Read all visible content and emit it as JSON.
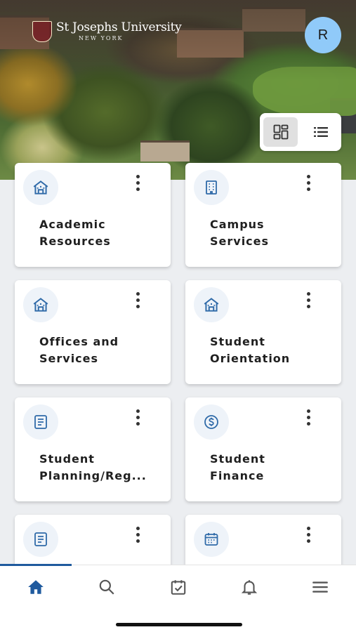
{
  "header": {
    "logo_name": "St Josephs University",
    "logo_subtitle": "NEW YORK",
    "avatar_initial": "R"
  },
  "view_toggle": {
    "selected": "grid",
    "options": [
      "grid-view-icon",
      "list-view-icon"
    ]
  },
  "cards": [
    {
      "title": "Academic\nResources",
      "icon": "building-icon"
    },
    {
      "title": "Campus\nServices",
      "icon": "office-building-icon"
    },
    {
      "title": "Offices and\nServices",
      "icon": "building-icon"
    },
    {
      "title": "Student\nOrientation",
      "icon": "building-icon"
    },
    {
      "title": "Student\nPlanning/Reg...",
      "icon": "book-icon"
    },
    {
      "title": "Student\nFinance",
      "icon": "dollar-coin-icon"
    },
    {
      "title": "",
      "icon": "book-icon"
    },
    {
      "title": "",
      "icon": "calendar-icon"
    }
  ],
  "bottom_nav": {
    "active": "home",
    "items": [
      "home-icon",
      "search-icon",
      "calendar-check-icon",
      "bell-icon",
      "menu-icon"
    ]
  },
  "colors": {
    "accent": "#1f5a9e",
    "icon_blue": "#2f6aa8",
    "icon_bg": "#eef3f9",
    "avatar_bg": "#90caf9",
    "page_bg": "#eceef1"
  }
}
